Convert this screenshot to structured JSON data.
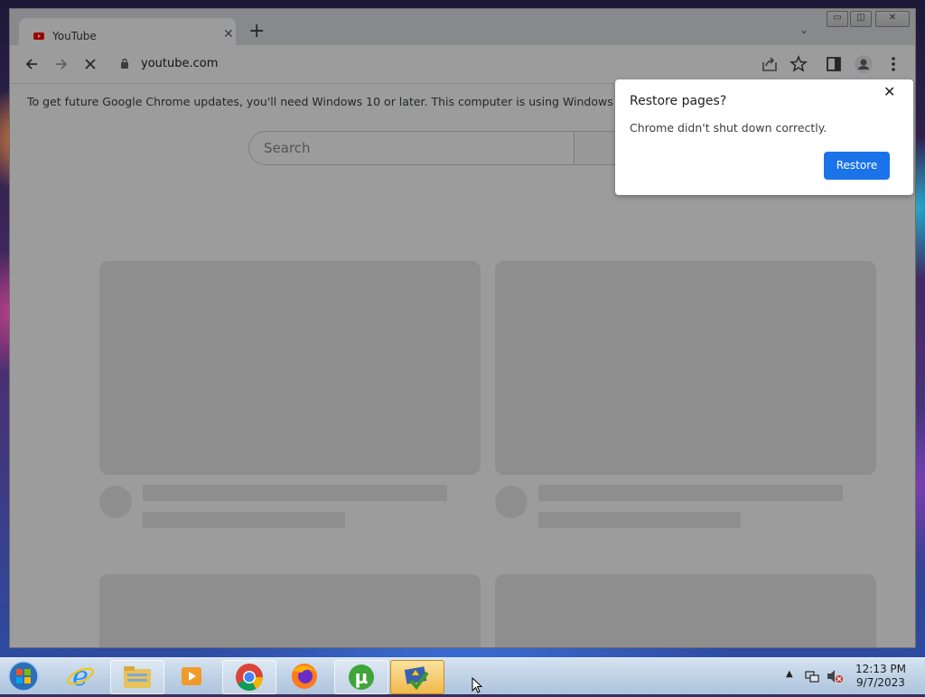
{
  "browser": {
    "tab": {
      "title": "YouTube"
    },
    "address": {
      "url": "youtube.com"
    },
    "infobar": {
      "message": "To get future Google Chrome updates, you'll need Windows 10 or later. This computer is using Windows 7."
    },
    "restore_bubble": {
      "title": "Restore pages?",
      "body": "Chrome didn't shut down correctly.",
      "button_label": "Restore"
    }
  },
  "page": {
    "search_placeholder": "Search"
  },
  "taskbar": {
    "items": [
      "internet-explorer",
      "windows-explorer",
      "media-player",
      "chrome",
      "firefox",
      "utorrent",
      "active-app"
    ],
    "clock": {
      "time": "12:13 PM",
      "date": "9/7/2023"
    }
  },
  "colors": {
    "accent": "#1a73e8",
    "youtube_red": "#ff0000",
    "overlay": "rgba(0,0,0,0.39)"
  }
}
